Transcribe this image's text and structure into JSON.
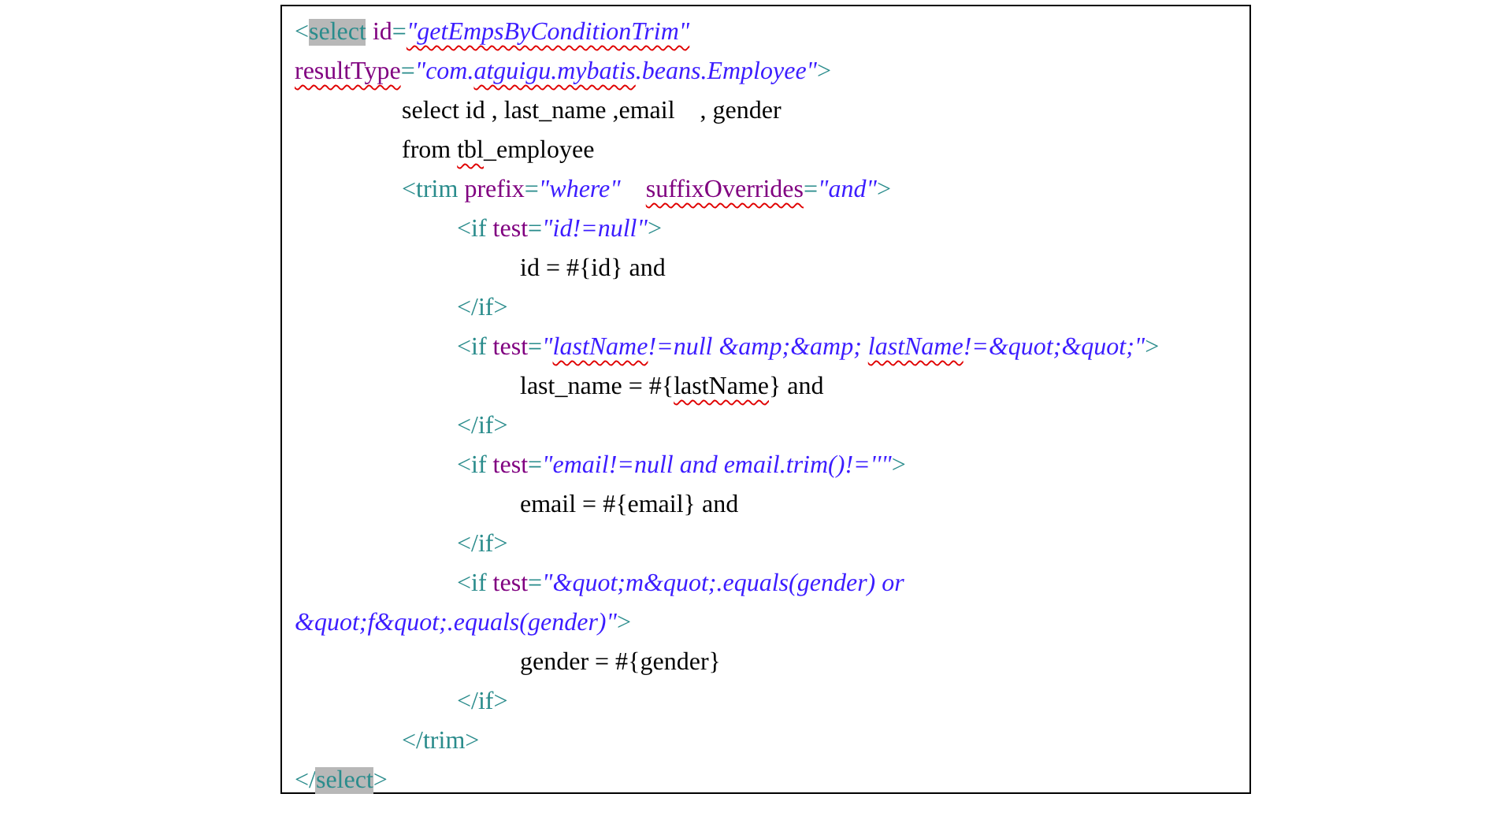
{
  "code_lines": [
    {
      "kind": "flush",
      "segments": [
        {
          "kind": "tag",
          "text": "<"
        },
        {
          "kind": "tag",
          "text": "select",
          "highlighted": true
        },
        {
          "kind": "attr",
          "text": " id"
        },
        {
          "kind": "tag",
          "text": "="
        },
        {
          "kind": "value",
          "text": "\"getEmpsByConditionTrim\"",
          "misspelled": true
        }
      ]
    },
    {
      "kind": "flush",
      "segments": [
        {
          "kind": "attr",
          "text": "resultType",
          "misspelled": true
        },
        {
          "kind": "tag",
          "text": "="
        },
        {
          "kind": "value",
          "text": "\"com."
        },
        {
          "kind": "value",
          "text": "atguigu.mybatis",
          "misspelled": true
        },
        {
          "kind": "value",
          "text": ".beans.Employee\""
        },
        {
          "kind": "tag",
          "text": ">"
        }
      ]
    },
    {
      "kind": "block",
      "segments": [
        {
          "kind": "text",
          "text": "select id , last_name ,email    , gender"
        }
      ]
    },
    {
      "kind": "block",
      "segments": [
        {
          "kind": "text",
          "text": "from "
        },
        {
          "kind": "text",
          "text": "tbl",
          "misspelled": true
        },
        {
          "kind": "text",
          "text": "_employee"
        }
      ]
    },
    {
      "kind": "block",
      "segments": [
        {
          "kind": "tag",
          "text": "<trim"
        },
        {
          "kind": "attr",
          "text": " prefix"
        },
        {
          "kind": "tag",
          "text": "="
        },
        {
          "kind": "value",
          "text": "\"where\"    "
        },
        {
          "kind": "attr",
          "text": "suffixOverrides",
          "misspelled": true
        },
        {
          "kind": "tag",
          "text": "="
        },
        {
          "kind": "value",
          "text": "\"and\""
        },
        {
          "kind": "tag",
          "text": ">"
        }
      ]
    },
    {
      "kind": "nested",
      "segments": [
        {
          "kind": "tag",
          "text": "<if"
        },
        {
          "kind": "attr",
          "text": " test"
        },
        {
          "kind": "tag",
          "text": "="
        },
        {
          "kind": "value",
          "text": "\"id!=null\""
        },
        {
          "kind": "tag",
          "text": ">"
        }
      ]
    },
    {
      "kind": "body",
      "segments": [
        {
          "kind": "text",
          "text": "id = #{id} and"
        }
      ]
    },
    {
      "kind": "nested",
      "segments": [
        {
          "kind": "tag",
          "text": "</if>"
        }
      ]
    },
    {
      "kind": "nested",
      "segments": [
        {
          "kind": "tag",
          "text": "<if"
        },
        {
          "kind": "attr",
          "text": " test"
        },
        {
          "kind": "tag",
          "text": "="
        },
        {
          "kind": "value",
          "text": "\""
        },
        {
          "kind": "value",
          "text": "lastName",
          "misspelled": true
        },
        {
          "kind": "value",
          "text": "!=null &amp;&amp; "
        },
        {
          "kind": "value",
          "text": "lastName",
          "misspelled": true
        },
        {
          "kind": "value",
          "text": "!=&quot;&quot;\""
        },
        {
          "kind": "tag",
          "text": ">"
        }
      ]
    },
    {
      "kind": "body",
      "segments": [
        {
          "kind": "text",
          "text": "last_name = #{"
        },
        {
          "kind": "text",
          "text": "lastName",
          "misspelled": true
        },
        {
          "kind": "text",
          "text": "} and"
        }
      ]
    },
    {
      "kind": "nested",
      "segments": [
        {
          "kind": "tag",
          "text": "</if>"
        }
      ]
    },
    {
      "kind": "nested",
      "segments": [
        {
          "kind": "tag",
          "text": "<if"
        },
        {
          "kind": "attr",
          "text": " test"
        },
        {
          "kind": "tag",
          "text": "="
        },
        {
          "kind": "value",
          "text": "\"email!=null and email.trim()!=''\""
        },
        {
          "kind": "tag",
          "text": ">"
        }
      ]
    },
    {
      "kind": "body",
      "segments": [
        {
          "kind": "text",
          "text": "email = #{email} and"
        }
      ]
    },
    {
      "kind": "nested",
      "segments": [
        {
          "kind": "tag",
          "text": "</if>"
        }
      ]
    },
    {
      "kind": "nested",
      "segments": [
        {
          "kind": "tag",
          "text": "<if"
        },
        {
          "kind": "attr",
          "text": " test"
        },
        {
          "kind": "tag",
          "text": "="
        },
        {
          "kind": "value",
          "text": "\"&quot;m&quot;.equals(gender) or"
        }
      ]
    },
    {
      "kind": "flush",
      "segments": [
        {
          "kind": "value",
          "text": "&quot;f&quot;.equals(gender)\""
        },
        {
          "kind": "tag",
          "text": ">"
        }
      ]
    },
    {
      "kind": "body",
      "segments": [
        {
          "kind": "text",
          "text": "gender = #{gender}"
        }
      ]
    },
    {
      "kind": "nested",
      "segments": [
        {
          "kind": "tag",
          "text": "</if>"
        }
      ]
    },
    {
      "kind": "block",
      "segments": [
        {
          "kind": "tag",
          "text": "</trim>"
        }
      ]
    },
    {
      "kind": "flush",
      "segments": [
        {
          "kind": "tag",
          "text": "</"
        },
        {
          "kind": "tag",
          "text": "select",
          "highlighted": true
        },
        {
          "kind": "tag",
          "text": ">"
        }
      ]
    }
  ]
}
